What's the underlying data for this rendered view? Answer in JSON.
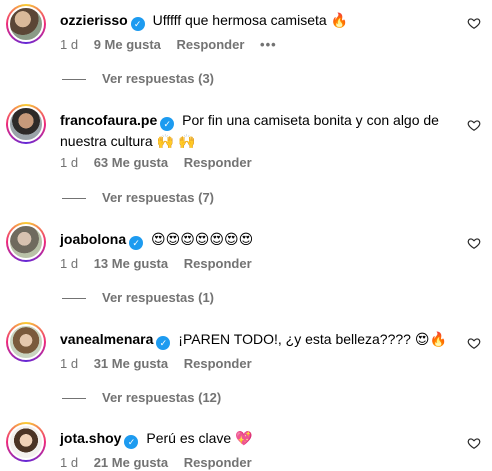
{
  "comments": [
    {
      "username": "ozzierisso",
      "text": "Ufffff que hermosa camiseta",
      "emoji": "🔥",
      "age": "1 d",
      "likes": "9 Me gusta",
      "reply_label": "Responder",
      "more_label": "•••",
      "replies_label": "Ver respuestas (3)"
    },
    {
      "username": "francofaura.pe",
      "text": "Por fin una camiseta bonita y con algo de nuestra cultura",
      "emoji": "🙌 🙌",
      "age": "1 d",
      "likes": "63 Me gusta",
      "reply_label": "Responder",
      "replies_label": "Ver respuestas (7)"
    },
    {
      "username": "joabolona",
      "text": "",
      "emoji": "😍😍😍😍😍😍😍",
      "age": "1 d",
      "likes": "13 Me gusta",
      "reply_label": "Responder",
      "replies_label": "Ver respuestas (1)"
    },
    {
      "username": "vanealmenara",
      "text": "¡PAREN TODO!, ¿y esta belleza????",
      "emoji": "😍🔥",
      "age": "1 d",
      "likes": "31 Me gusta",
      "reply_label": "Responder",
      "replies_label": "Ver respuestas (12)"
    },
    {
      "username": "jota.shoy",
      "text": "Perú es clave",
      "emoji": "💖",
      "age": "1 d",
      "likes": "21 Me gusta",
      "reply_label": "Responder"
    }
  ],
  "icons": {
    "verified": "verified-badge-icon",
    "like": "heart-outline-icon"
  },
  "colors": {
    "verified": "#1d9bf0",
    "meta_text": "#737373"
  }
}
